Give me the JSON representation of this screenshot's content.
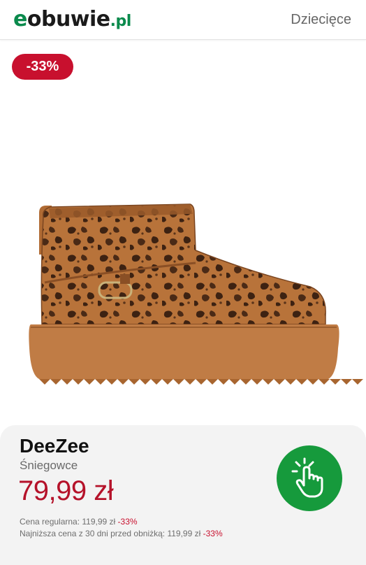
{
  "header": {
    "logo": {
      "prefix": "e",
      "main": "obuwie",
      "tld": ".pl"
    },
    "category": "Dziecięce"
  },
  "badge": {
    "discount": "-33%"
  },
  "product": {
    "image_icon": "leopard-print-boot",
    "brand": "DeeZee",
    "category": "Śniegowce",
    "price": "79,99 zł",
    "regular_price_label": "Cena regularna: 119,99 zł",
    "regular_discount": "-33%",
    "lowest_price_label": "Najniższa cena z 30 dni przed obniżką: 119,99 zł",
    "lowest_discount": "-33%"
  },
  "tap_button": {
    "icon": "tap-hand-icon"
  },
  "colors": {
    "brand_green": "#0a8a4c",
    "sale_red": "#c8102e",
    "price_red": "#b5122a",
    "button_green": "#169a3c"
  }
}
